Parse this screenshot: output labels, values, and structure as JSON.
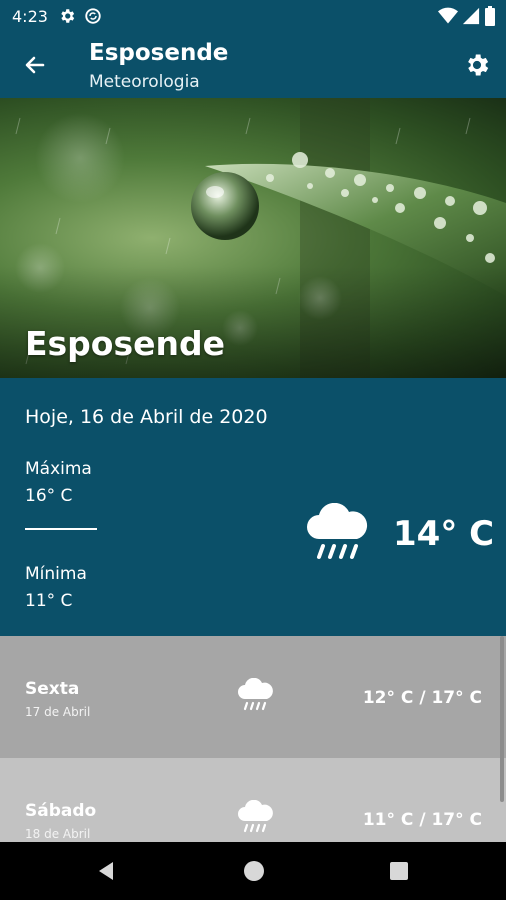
{
  "status_bar": {
    "time": "4:23",
    "icons": [
      "gear-icon",
      "sync-icon",
      "wifi-icon",
      "signal-icon",
      "battery-icon"
    ]
  },
  "app_bar": {
    "title": "Esposende",
    "subtitle": "Meteorologia",
    "back_icon": "arrow-left-icon",
    "settings_icon": "gear-icon"
  },
  "hero": {
    "city": "Esposende"
  },
  "today": {
    "date": "Hoje, 16 de Abril de 2020",
    "max_label": "Máxima",
    "max_value": "16° C",
    "min_label": "Mínima",
    "min_value": "11° C",
    "current_temp": "14° C",
    "icon": "rain-cloud-icon"
  },
  "forecast": [
    {
      "day": "Sexta",
      "date": "17 de Abril",
      "temps": "12° C / 17° C",
      "icon": "rain-cloud-icon"
    },
    {
      "day": "Sábado",
      "date": "18 de Abril",
      "temps": "11° C / 17° C",
      "icon": "rain-cloud-icon"
    }
  ],
  "colors": {
    "primary": "#0b5069",
    "row_dark": "#a6a6a6",
    "row_light": "#c2c2c2"
  }
}
